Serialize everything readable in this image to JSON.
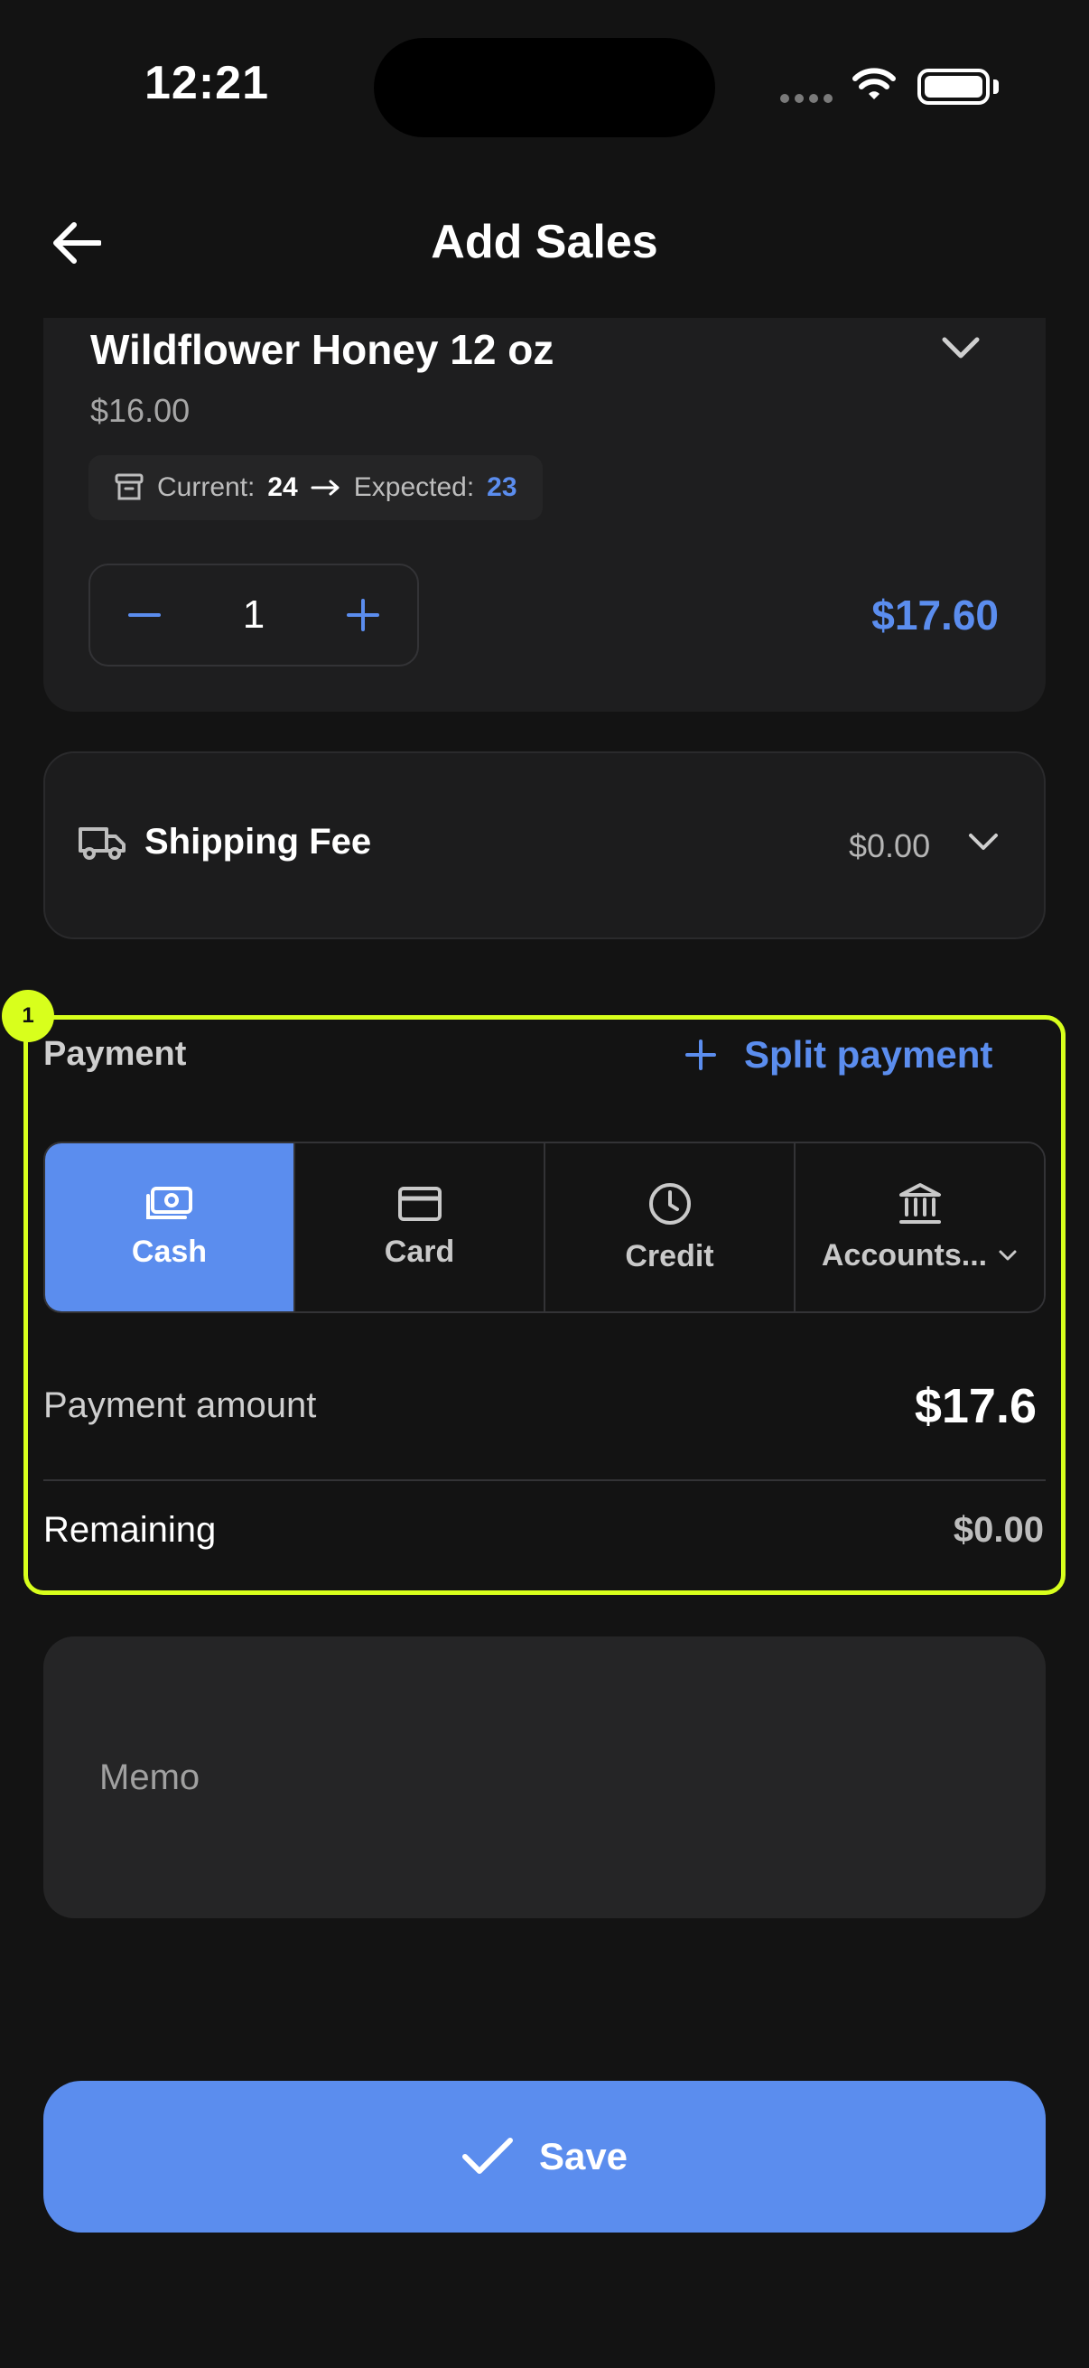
{
  "status_bar": {
    "time": "12:21"
  },
  "header": {
    "title": "Add Sales"
  },
  "product": {
    "name": "Wildflower Honey 12 oz",
    "price": "$16.00",
    "stock_current_label": "Current:",
    "stock_current_value": "24",
    "stock_expected_label": "Expected:",
    "stock_expected_value": "23",
    "quantity": "1",
    "line_total": "$17.60"
  },
  "shipping": {
    "label": "Shipping Fee",
    "value": "$0.00"
  },
  "payment": {
    "title": "Payment",
    "split_label": "Split payment",
    "badge": "1",
    "methods": [
      {
        "label": "Cash",
        "icon": "cash-icon",
        "selected": true
      },
      {
        "label": "Card",
        "icon": "card-icon",
        "selected": false
      },
      {
        "label": "Credit",
        "icon": "clock-icon",
        "selected": false
      },
      {
        "label": "Accounts...",
        "icon": "bank-icon",
        "selected": false
      }
    ],
    "amount_label": "Payment amount",
    "amount_value": "$17.6",
    "remaining_label": "Remaining",
    "remaining_value": "$0.00"
  },
  "memo": {
    "placeholder": "Memo"
  },
  "save": {
    "label": "Save"
  },
  "colors": {
    "accent": "#5b8dee",
    "highlight": "#d8ff1c",
    "background": "#131313"
  }
}
